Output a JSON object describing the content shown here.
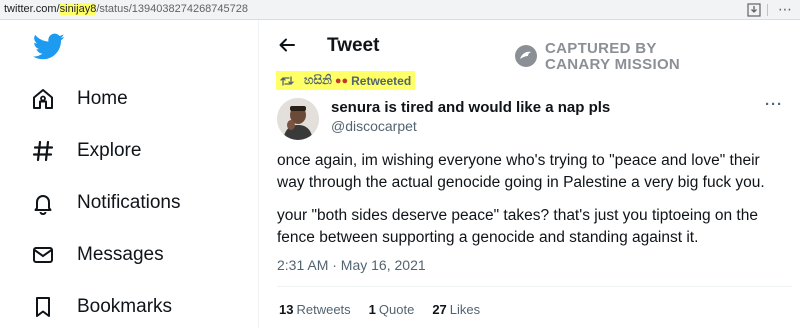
{
  "browser": {
    "url_prefix": "twitter.com/",
    "url_highlight": "sinijay8",
    "url_suffix": "/status/1394038274268745728"
  },
  "sidebar": {
    "items": [
      {
        "label": "Home",
        "icon": "home-icon"
      },
      {
        "label": "Explore",
        "icon": "hashtag-icon"
      },
      {
        "label": "Notifications",
        "icon": "bell-icon"
      },
      {
        "label": "Messages",
        "icon": "envelope-icon"
      },
      {
        "label": "Bookmarks",
        "icon": "bookmark-icon"
      }
    ]
  },
  "header": {
    "title": "Tweet"
  },
  "watermark": {
    "line1": "CAPTURED BY",
    "line2": "CANARY MISSION"
  },
  "retweet": {
    "user": "හසිනි",
    "label": "Retweeted"
  },
  "tweet": {
    "author_name": "senura is tired and would like a nap pls",
    "handle": "@discocarpet",
    "paragraph1": "once again, im wishing everyone who's trying to \"peace and love\" their way through the actual genocide going in Palestine a very big fuck you.",
    "paragraph2": "your \"both sides deserve peace\" takes? that's just you tiptoeing on the fence between supporting a genocide and standing against it.",
    "timestamp": "2:31 AM · May 16, 2021",
    "retweets_count": "13",
    "retweets_label": "Retweets",
    "quotes_count": "1",
    "quotes_label": "Quote",
    "likes_count": "27",
    "likes_label": "Likes"
  },
  "colors": {
    "twitter_blue": "#1d9bf0",
    "highlight": "#ffff66",
    "secondary_text": "#536471"
  }
}
